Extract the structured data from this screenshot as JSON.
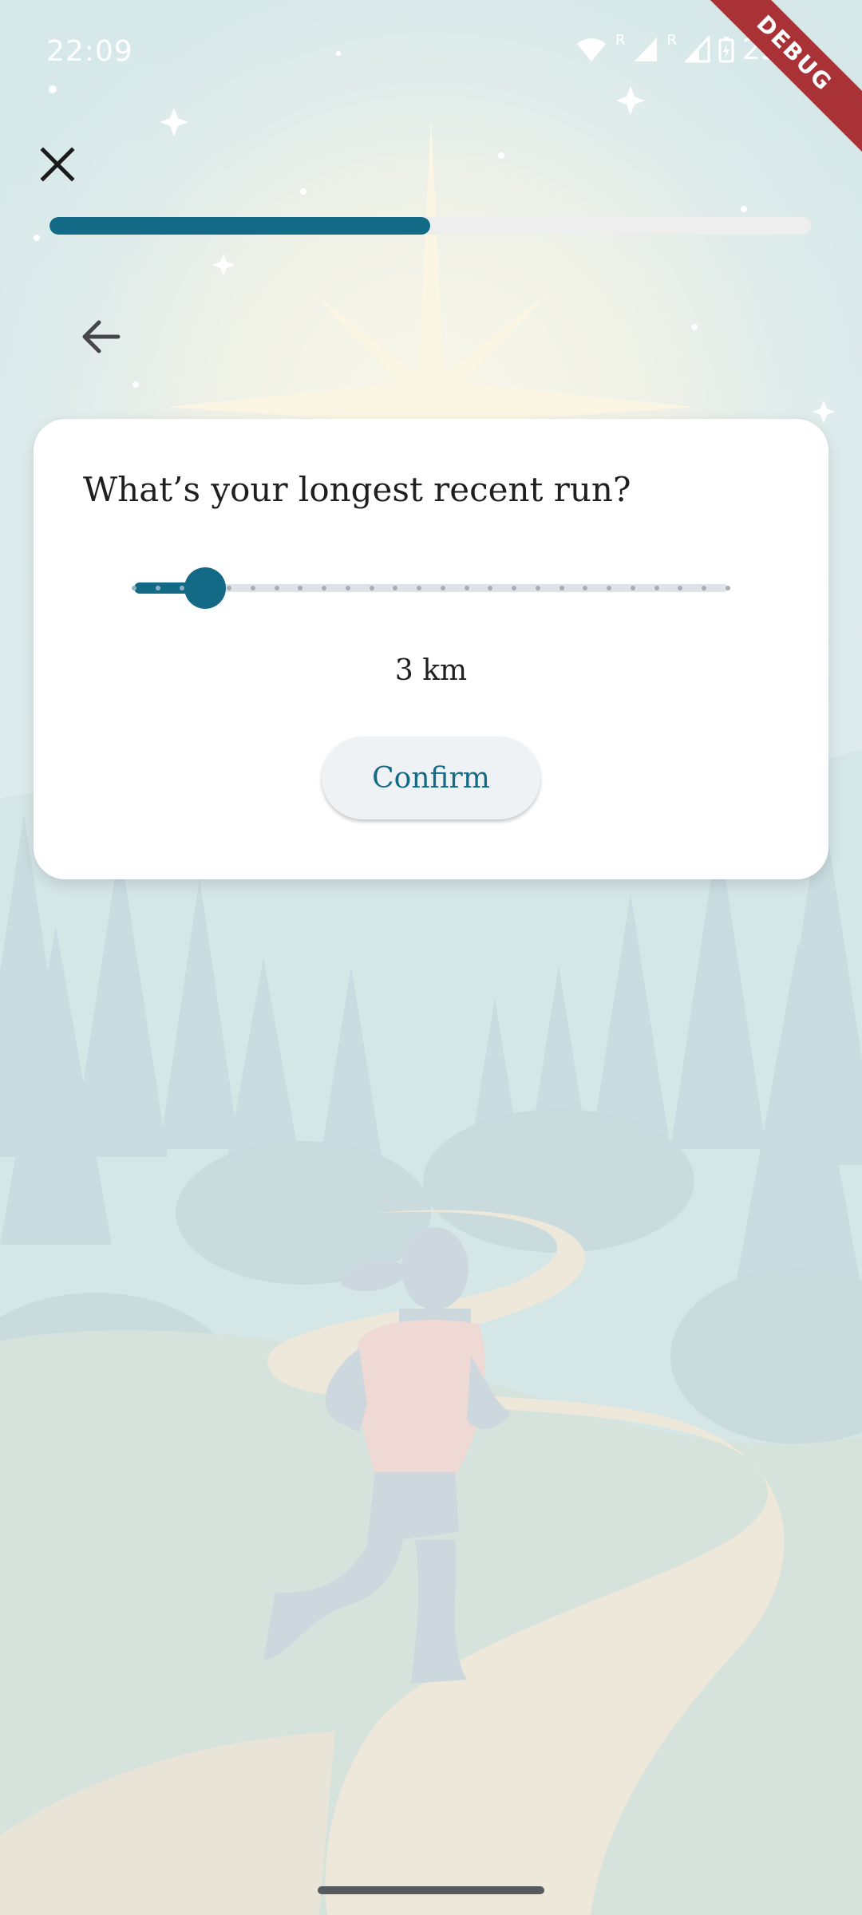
{
  "status_bar": {
    "time": "22:09",
    "battery": "25%",
    "roaming_1": "R",
    "roaming_2": "R"
  },
  "debug_banner": "DEBUG",
  "progress": {
    "value": 0.5
  },
  "question": "What’s your longest recent run?",
  "slider": {
    "min": 0,
    "max": 25,
    "value": 3,
    "divisions": 25
  },
  "value_text": "3 km",
  "confirm_label": "Confirm",
  "colors": {
    "accent": "#136a86",
    "progress_track": "#eeeeee",
    "card": "#ffffff",
    "button_bg": "#eff2f5",
    "debug": "#a83236"
  },
  "icons": {
    "close": "close-icon",
    "back": "arrow-left-icon",
    "wifi": "wifi-icon",
    "signal": "cell-signal-icon",
    "battery": "battery-charging-icon"
  }
}
